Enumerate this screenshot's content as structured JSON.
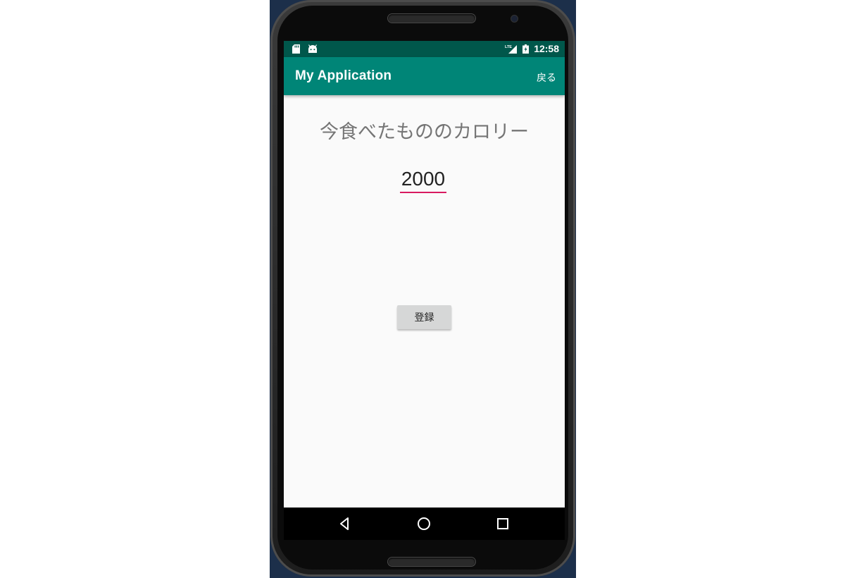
{
  "status_bar": {
    "time": "12:58",
    "icons": [
      "sd-card-icon",
      "android-icon",
      "lte-signal-icon",
      "battery-charging-icon"
    ],
    "network": "LTE"
  },
  "app_bar": {
    "title": "My Application",
    "back_label": "戻る",
    "color": "#008577"
  },
  "main": {
    "heading": "今食べたもののカロリー",
    "calorie_value": "2000",
    "register_label": "登録",
    "accent_color": "#d81b60"
  },
  "nav_bar": {
    "buttons": [
      "back-icon",
      "home-icon",
      "recents-icon"
    ]
  }
}
